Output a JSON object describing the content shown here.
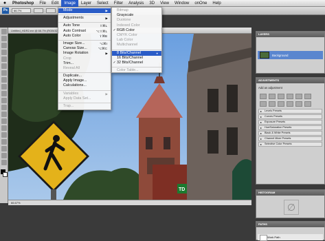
{
  "menubar": {
    "app": "Photoshop",
    "items": [
      "File",
      "Edit",
      "Image",
      "Layer",
      "Select",
      "Filter",
      "Analysis",
      "3D",
      "View",
      "Window",
      "onOne",
      "Help"
    ],
    "active": "Image"
  },
  "optbar": {
    "app_badge": "Ps",
    "zoom": "66.7%"
  },
  "document": {
    "tab_title": "Untitled_HDR2.exr @ 66.7% (RGB/32) *",
    "status_zoom": "66.67%"
  },
  "image_menu": {
    "items": [
      {
        "label": "Mode",
        "arrow": true,
        "highlight": true
      },
      {
        "sep": true
      },
      {
        "label": "Adjustments",
        "arrow": true
      },
      {
        "sep": true
      },
      {
        "label": "Auto Tone",
        "shortcut": "⇧⌘L"
      },
      {
        "label": "Auto Contrast",
        "shortcut": "⌥⇧⌘L"
      },
      {
        "label": "Auto Color",
        "shortcut": "⇧⌘B"
      },
      {
        "sep": true
      },
      {
        "label": "Image Size...",
        "shortcut": "⌥⌘I"
      },
      {
        "label": "Canvas Size...",
        "shortcut": "⌥⌘C"
      },
      {
        "label": "Image Rotation",
        "arrow": true
      },
      {
        "label": "Crop",
        "disabled": true
      },
      {
        "label": "Trim..."
      },
      {
        "label": "Reveal All",
        "disabled": true
      },
      {
        "sep": true
      },
      {
        "label": "Duplicate..."
      },
      {
        "label": "Apply Image..."
      },
      {
        "label": "Calculations..."
      },
      {
        "sep": true
      },
      {
        "label": "Variables",
        "arrow": true,
        "disabled": true
      },
      {
        "label": "Apply Data Set...",
        "disabled": true
      },
      {
        "sep": true
      },
      {
        "label": "Trap...",
        "disabled": true
      }
    ]
  },
  "mode_menu": {
    "items": [
      {
        "label": "Bitmap",
        "disabled": true
      },
      {
        "label": "Grayscale"
      },
      {
        "label": "Duotone",
        "disabled": true
      },
      {
        "label": "Indexed Color",
        "disabled": true
      },
      {
        "label": "RGB Color",
        "checked": true
      },
      {
        "label": "CMYK Color",
        "disabled": true
      },
      {
        "label": "Lab Color",
        "disabled": true
      },
      {
        "label": "Multichannel",
        "disabled": true
      },
      {
        "sep": true
      },
      {
        "label": "8 Bits/Channel",
        "highlight": true
      },
      {
        "label": "16 Bits/Channel"
      },
      {
        "label": "32 Bits/Channel",
        "checked": true
      },
      {
        "sep": true
      },
      {
        "label": "Color Table...",
        "disabled": true
      }
    ]
  },
  "panels": {
    "layers": {
      "title": "LAYERS",
      "layer_name": "Background"
    },
    "adjustments": {
      "title": "ADJUSTMENTS",
      "subtitle": "Add an adjustment",
      "presets": [
        "Levels Presets",
        "Curves Presets",
        "Exposure Presets",
        "Hue/Saturation Presets",
        "Black & White Presets",
        "Channel Mixer Presets",
        "Selective Color Presets"
      ]
    },
    "histogram": {
      "title": "HISTOGRAM",
      "empty_symbol": "∅"
    },
    "paths": {
      "title": "PATHS",
      "path_name": "Work Path"
    }
  },
  "colors": {
    "menu_highlight": "#2a5cc7",
    "sky": "#78a8e0",
    "sign_yellow": "#e4b21a"
  }
}
